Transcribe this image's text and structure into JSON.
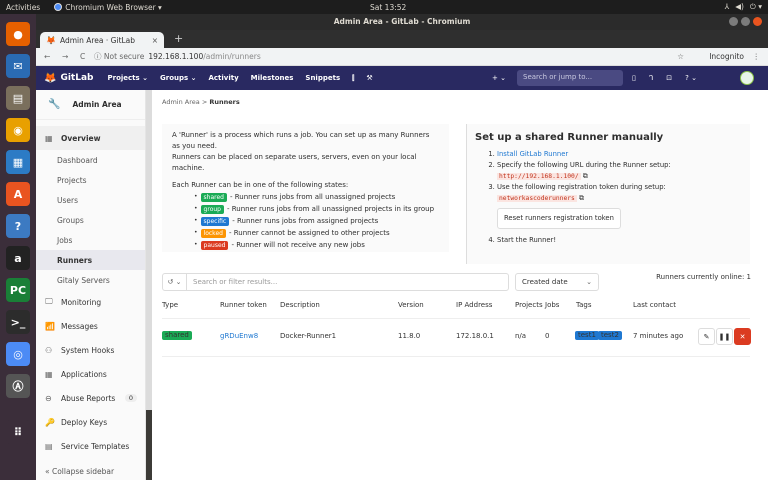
{
  "os": {
    "activities": "Activities",
    "app_name": "Chromium Web Browser ▾",
    "clock": "Sat 13:52",
    "tray": [
      "⅄",
      "◀)",
      "⏻ ▾"
    ]
  },
  "window": {
    "title": "Admin Area - GitLab - Chromium"
  },
  "dock": [
    {
      "name": "firefox-icon",
      "glyph": "●",
      "color": "#e66000"
    },
    {
      "name": "thunderbird-icon",
      "glyph": "✉",
      "color": "#2a6bb3"
    },
    {
      "name": "files-icon",
      "glyph": "▤",
      "color": "#7a6f5c"
    },
    {
      "name": "rhythmbox-icon",
      "glyph": "◉",
      "color": "#e8a000"
    },
    {
      "name": "writer-icon",
      "glyph": "▦",
      "color": "#2c7bc5"
    },
    {
      "name": "software-icon",
      "glyph": "A",
      "color": "#e95420"
    },
    {
      "name": "help-icon",
      "glyph": "?",
      "color": "#3c7ac2"
    },
    {
      "name": "amazon-icon",
      "glyph": "a",
      "color": "#222"
    },
    {
      "name": "pycharm-icon",
      "glyph": "PC",
      "color": "#1a7f37"
    },
    {
      "name": "terminal-icon",
      "glyph": ">_",
      "color": "#2c2c2c"
    },
    {
      "name": "chromium-icon",
      "glyph": "◎",
      "color": "#4c8bf5"
    },
    {
      "name": "updater-icon",
      "glyph": "Ⓐ",
      "color": "#555"
    },
    {
      "name": "app-grid-icon",
      "glyph": "⠿",
      "color": "#3b2e3a"
    }
  ],
  "browser": {
    "tab_title": "Admin Area · GitLab",
    "tab_close": "×",
    "new_tab": "+",
    "back": "←",
    "forward": "→",
    "reload": "C",
    "security": "ⓘ Not secure",
    "url_host": "192.168.1.100",
    "url_path": "/admin/runners",
    "star": "☆",
    "incognito": "Incognito",
    "menu": "⋮"
  },
  "gitlab_header": {
    "brand": "GitLab",
    "nav": [
      "Projects ⌄",
      "Groups ⌄",
      "Activity",
      "Milestones",
      "Snippets",
      "⫿",
      "⚒"
    ],
    "plus": "+ ⌄",
    "search_placeholder": "Search or jump to...",
    "right_icons": [
      "▯",
      "ᒉ",
      "⊡",
      "? ⌄"
    ]
  },
  "sidebar": {
    "title": "Admin Area",
    "overview": "Overview",
    "sub_items": [
      "Dashboard",
      "Projects",
      "Users",
      "Groups",
      "Jobs",
      "Runners",
      "Gitaly Servers"
    ],
    "active": "Runners",
    "items": [
      {
        "icon": "🖵",
        "label": "Monitoring"
      },
      {
        "icon": "📶",
        "label": "Messages"
      },
      {
        "icon": "⚇",
        "label": "System Hooks"
      },
      {
        "icon": "▦",
        "label": "Applications"
      },
      {
        "icon": "⊖",
        "label": "Abuse Reports",
        "badge": "0"
      },
      {
        "icon": "🔑",
        "label": "Deploy Keys"
      },
      {
        "icon": "▤",
        "label": "Service Templates"
      }
    ],
    "collapse": "Collapse sidebar"
  },
  "breadcrumb": {
    "parent": "Admin Area",
    "sep": ">",
    "current": "Runners"
  },
  "info": {
    "p1": "A 'Runner' is a process which runs a job. You can set up as many Runners as you need.",
    "p2": "Runners can be placed on separate users, servers, even on your local machine.",
    "p3": "Each Runner can be in one of the following states:",
    "states": [
      {
        "label": "shared",
        "color": "#1aaa55",
        "text": "- Runner runs jobs from all unassigned projects"
      },
      {
        "label": "group",
        "color": "#1aaa55",
        "text": "- Runner runs jobs from all unassigned projects in its group"
      },
      {
        "label": "specific",
        "color": "#1f78d1",
        "text": "- Runner runs jobs from assigned projects"
      },
      {
        "label": "locked",
        "color": "#fc9403",
        "text": "- Runner cannot be assigned to other projects"
      },
      {
        "label": "paused",
        "color": "#db3b21",
        "text": "- Runner will not receive any new jobs"
      }
    ]
  },
  "setup": {
    "title": "Set up a shared Runner manually",
    "step1": "Install GitLab Runner",
    "step2": "Specify the following URL during the Runner setup:",
    "url": "http://192.168.1.100/",
    "step3": "Use the following registration token during setup:",
    "token": "networkascoderunners",
    "reset_button": "Reset runners registration token",
    "step4": "Start the Runner!"
  },
  "filter": {
    "placeholder": "Search or filter results...",
    "sort": "Created date",
    "online": "Runners currently online: 1"
  },
  "table": {
    "headers": [
      "Type",
      "Runner token",
      "Description",
      "Version",
      "IP Address",
      "Projects",
      "Jobs",
      "Tags",
      "Last contact"
    ],
    "rows": [
      {
        "type": "shared",
        "token": "gRDuEnw8",
        "description": "Docker-Runner1",
        "version": "11.8.0",
        "ip": "172.18.0.1",
        "projects": "n/a",
        "jobs": "0",
        "tags": [
          "test1",
          "test2"
        ],
        "last_contact": "7 minutes ago"
      }
    ]
  },
  "colors": {
    "gitlab_nav": "#292961",
    "link": "#1f78d1",
    "success": "#1aaa55",
    "danger": "#db3b21"
  }
}
